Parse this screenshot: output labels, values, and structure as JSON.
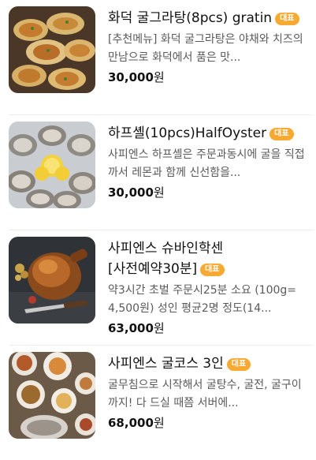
{
  "menu_items": [
    {
      "name": "화덕 굴그라탕(8pcs) gratin",
      "badge": "대표",
      "description": "[추천메뉴] 화덕 굴그라탕은 야채와 치즈의 만남으로 화덕에서 품은 맛...",
      "price": "30,000",
      "currency": "원",
      "image_icon": "gratin-oysters-photo"
    },
    {
      "name": "하프셸(10pcs)HalfOyster",
      "badge": "대표",
      "description": "사피엔스 하프셸은 주문과동시에 굴을 직접까서 레몬과 함께 신선함을...",
      "price": "30,000",
      "currency": "원",
      "image_icon": "raw-oysters-lemon-photo"
    },
    {
      "name": "사피엔스 슈바인학센[사전예약30분]",
      "badge": "대표",
      "description": "약3시간 초벌 주문시25분 소요 (100g= 4,500원) 성인 평균2명 정도(14...",
      "price": "63,000",
      "currency": "원",
      "image_icon": "schweinshaxe-photo"
    },
    {
      "name": "사피엔스 굴코스 3인",
      "badge": "대표",
      "description": "굴무침으로 시작해서 굴탕수, 굴전, 굴구이까지! 다 드실 때쯤 서버에...",
      "price": "68,000",
      "currency": "원",
      "image_icon": "oyster-course-spread-photo"
    }
  ]
}
